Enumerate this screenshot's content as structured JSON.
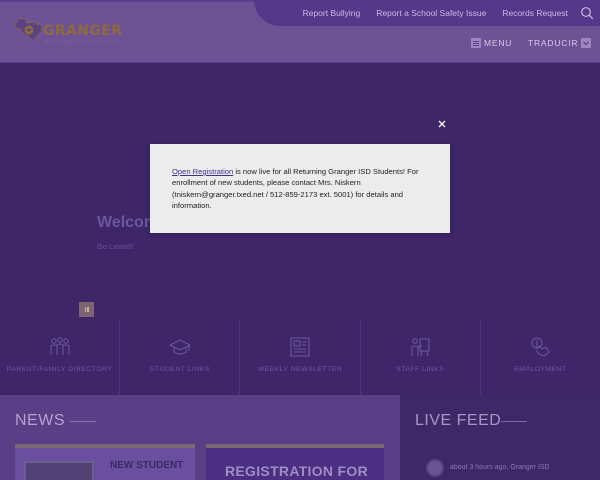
{
  "header": {
    "top_links": [
      "Report Bullying",
      "Report a School Safety Issue",
      "Records Request"
    ],
    "logo_text": "GRANGER",
    "logo_subtitle": "INDEPENDENT SCHOOL DISTRICT",
    "menu_label": "MENU",
    "translate_label": "TRADUCIR"
  },
  "hero": {
    "title": "Welcom",
    "subtitle": "Go Lions!!!"
  },
  "quick_links": [
    {
      "label": "PARENT/FAMILY DIRECTORY",
      "icon": "family-icon"
    },
    {
      "label": "STUDENT LINKS",
      "icon": "graduation-cap-icon"
    },
    {
      "label": "WEEKLY NEWSLETTER",
      "icon": "newspaper-icon"
    },
    {
      "label": "STAFF LINKS",
      "icon": "staff-board-icon"
    },
    {
      "label": "EMPLOYMENT",
      "icon": "hand-pointer-icon"
    }
  ],
  "news": {
    "title": "NEWS",
    "card1_text": "NEW STUDENT",
    "card2_text": "REGISTRATION FOR"
  },
  "live_feed": {
    "title": "LIVE FEED",
    "meta": "about 3 hours ago, Granger ISD"
  },
  "modal": {
    "link_text": "Open Registration",
    "body_text": " is now live for all Returning Granger ISD Students! For enrollment of new students, please contact Mrs. Niskern (tniskern@granger.txed.net / 512-859-2173 ext. 5001) for details and information."
  },
  "colors": {
    "brand_purple": "#4f2d87",
    "brand_gold": "#8d6b3e"
  }
}
